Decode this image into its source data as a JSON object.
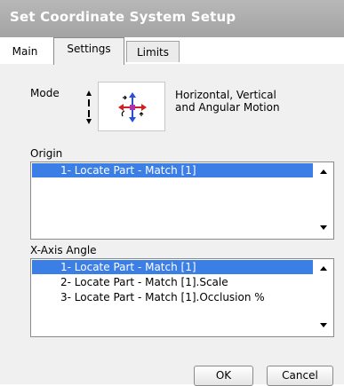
{
  "window": {
    "title": "Set Coordinate System Setup"
  },
  "tabs": [
    {
      "label": "Main"
    },
    {
      "label": "Settings"
    },
    {
      "label": "Limits"
    }
  ],
  "mode": {
    "label": "Mode",
    "description_line1": "Horizontal, Vertical",
    "description_line2": "and Angular Motion",
    "icon": "move-rotate-icon"
  },
  "origin": {
    "label": "Origin",
    "items": [
      "1- Locate Part - Match [1]"
    ],
    "selected_index": 0
  },
  "x_axis_angle": {
    "label": "X-Axis Angle",
    "items": [
      "1- Locate Part - Match [1]",
      "2- Locate Part - Match [1].Scale",
      "3- Locate Part - Match [1].Occlusion %"
    ],
    "selected_index": 0
  },
  "buttons": {
    "ok": "OK",
    "cancel": "Cancel"
  },
  "colors": {
    "title_bar": "#a9a9a9",
    "selection": "#3a7ee6",
    "panel": "#f0f0f0"
  }
}
